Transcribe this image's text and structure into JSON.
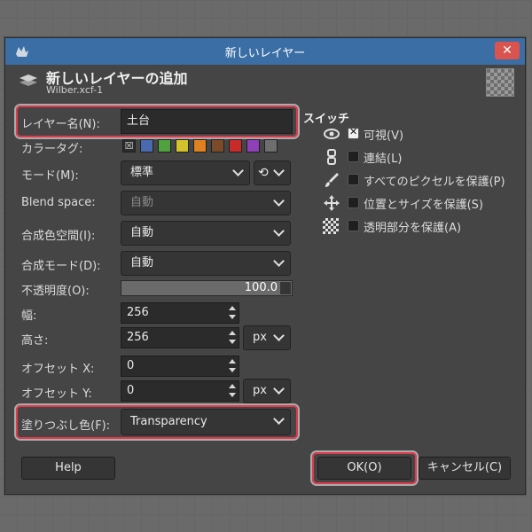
{
  "window": {
    "title": "新しいレイヤー",
    "close_glyph": "✕"
  },
  "header": {
    "title": "新しいレイヤーの追加",
    "subtitle": "Wilber.xcf-1"
  },
  "form": {
    "layer_name": {
      "label": "レイヤー名(N):",
      "value": "土台"
    },
    "color_tag": {
      "label": "カラータグ:",
      "colors": [
        "#4a6ab0",
        "#4fa23d",
        "#d4c22a",
        "#e0801f",
        "#7b4a2a",
        "#c92a2a",
        "#8f3fb8",
        "#6e6e6e"
      ]
    },
    "mode": {
      "label": "モード(M):",
      "value": "標準"
    },
    "blend_space": {
      "label": "Blend space:",
      "value": "自動"
    },
    "composite_space": {
      "label": "合成色空間(I):",
      "value": "自動"
    },
    "composite_mode": {
      "label": "合成モード(D):",
      "value": "自動"
    },
    "opacity": {
      "label": "不透明度(O):",
      "value": "100.0"
    },
    "width": {
      "label": "幅:",
      "value": "256"
    },
    "height": {
      "label": "高さ:",
      "value": "256",
      "unit": "px"
    },
    "offset_x": {
      "label": "オフセット X:",
      "value": "0"
    },
    "offset_y": {
      "label": "オフセット Y:",
      "value": "0",
      "unit": "px"
    },
    "fill": {
      "label": "塗りつぶし色(F):",
      "value": "Transparency"
    }
  },
  "switches": {
    "heading": "スイッチ",
    "items": [
      {
        "icon": "eye-icon",
        "label": "可視(V)",
        "checked": true
      },
      {
        "icon": "chain-icon",
        "label": "連結(L)",
        "checked": false
      },
      {
        "icon": "brush-icon",
        "label": "すべてのピクセルを保護(P)",
        "checked": false
      },
      {
        "icon": "move-icon",
        "label": "位置とサイズを保護(S)",
        "checked": false
      },
      {
        "icon": "checker-icon",
        "label": "透明部分を保護(A)",
        "checked": false
      }
    ]
  },
  "buttons": {
    "help": "Help",
    "ok": "OK(O)",
    "cancel": "キャンセル(C)"
  },
  "colors": {
    "titlebar": "#3a6ea5",
    "close": "#d9534f",
    "highlight": "#e03a4c"
  }
}
